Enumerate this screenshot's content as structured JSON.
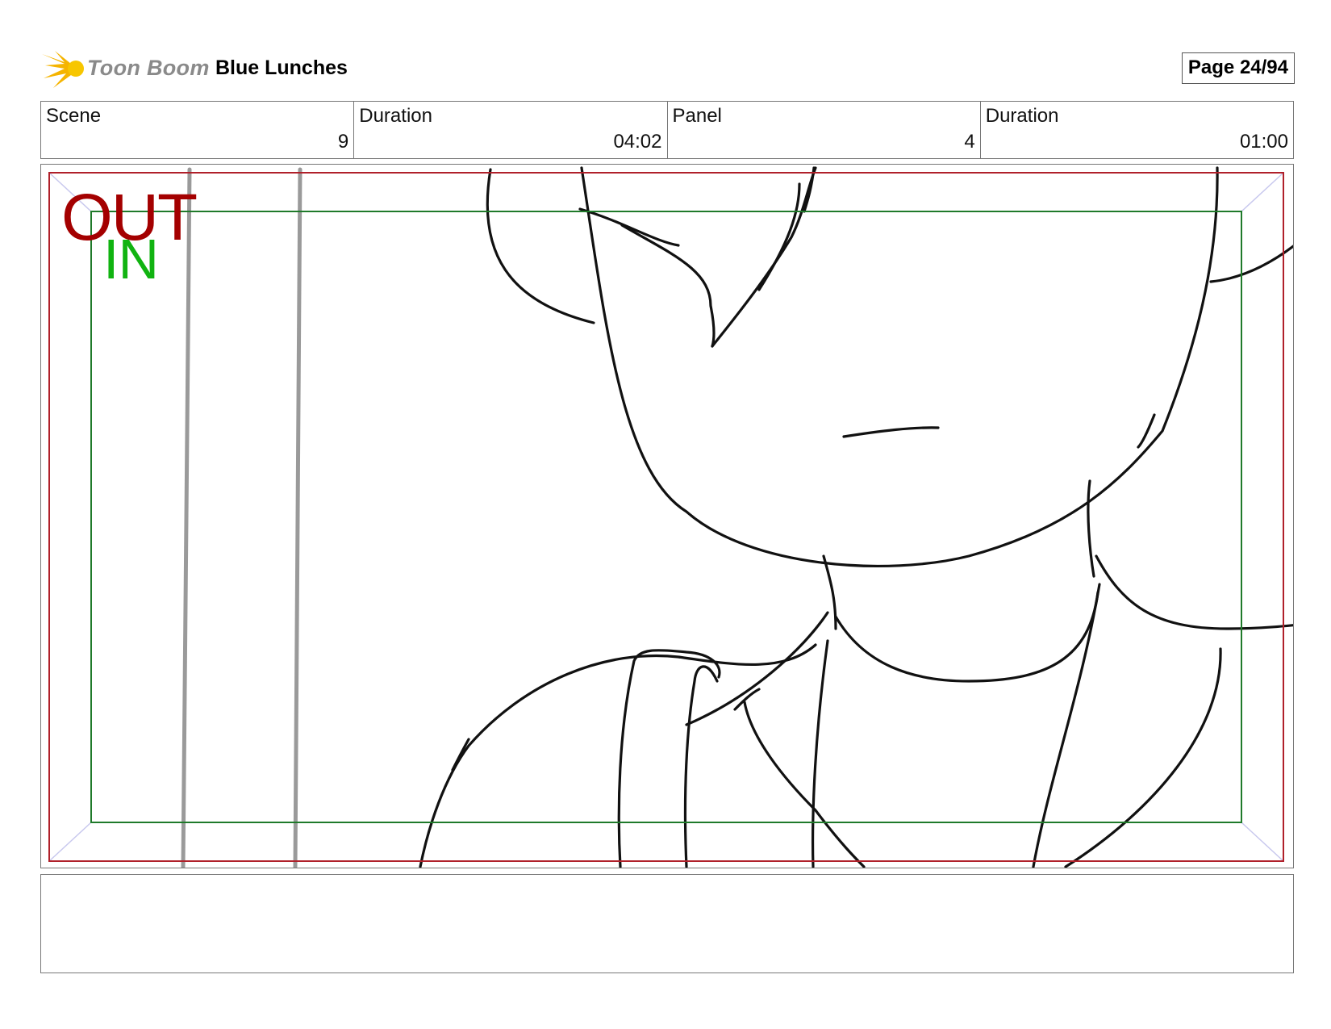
{
  "header": {
    "logo_text": "Toon Boom",
    "project_title": "Blue Lunches",
    "page_label": "Page 24/94"
  },
  "info": {
    "scene_label": "Scene",
    "scene_value": "9",
    "scene_duration_label": "Duration",
    "scene_duration_value": "04:02",
    "panel_label": "Panel",
    "panel_value": "4",
    "panel_duration_label": "Duration",
    "panel_duration_value": "01:00"
  },
  "panel": {
    "out_label": "OUT",
    "in_label": "IN",
    "out_color": "#a40000",
    "in_color": "#11b311"
  },
  "notes": {
    "text": ""
  }
}
